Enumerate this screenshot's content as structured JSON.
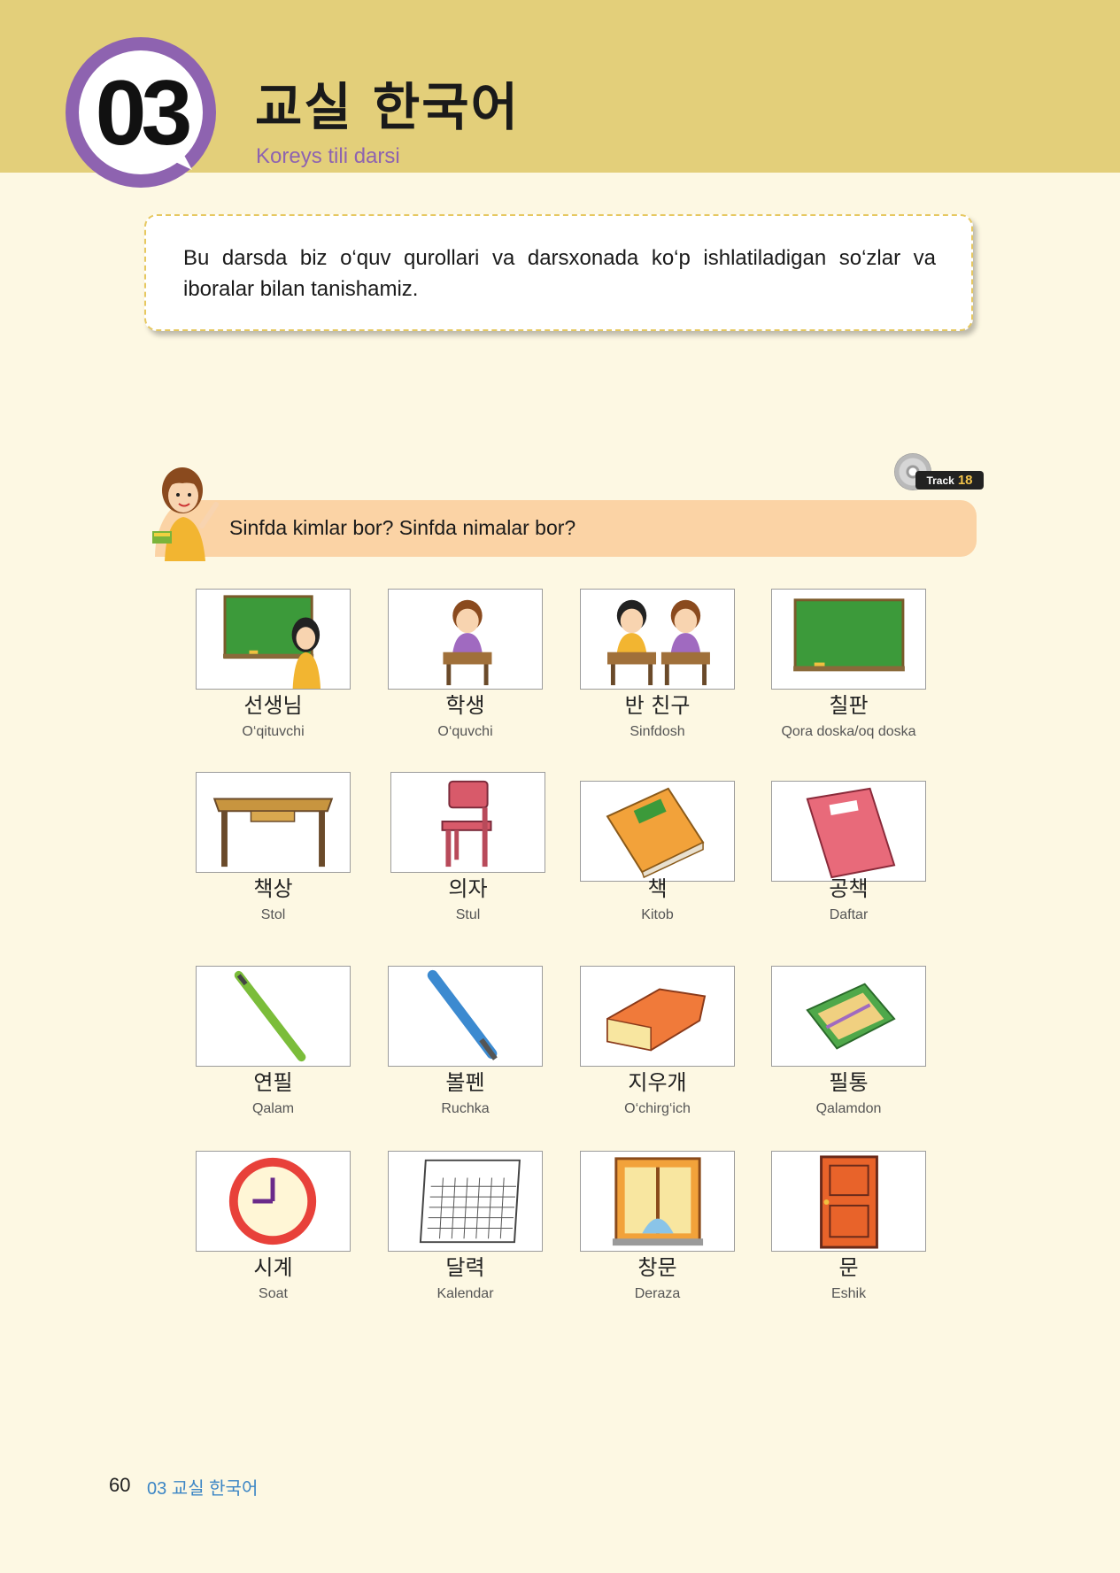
{
  "lesson": {
    "number": "03",
    "title_ko": "교실 한국어",
    "title_uz": "Koreys tili darsi"
  },
  "intro": "Bu darsda biz o‘quv qurollari va darsxonada ko‘p ishlatiladigan so‘zlar va iboralar bilan tanishamiz.",
  "track": {
    "label": "Track",
    "number": "18"
  },
  "prompt": "Sinfda kimlar bor? Sinfda nimalar bor?",
  "vocabulary": [
    {
      "ko": "선생님",
      "uz": "O‘qituvchi",
      "icon": "teacher-blackboard-icon"
    },
    {
      "ko": "학생",
      "uz": "O‘quvchi",
      "icon": "student-desk-icon"
    },
    {
      "ko": "반 친구",
      "uz": "Sinfdosh",
      "icon": "classmates-icon"
    },
    {
      "ko": "칠판",
      "uz": "Qora doska/oq doska",
      "icon": "blackboard-icon"
    },
    {
      "ko": "책상",
      "uz": "Stol",
      "icon": "desk-icon"
    },
    {
      "ko": "의자",
      "uz": "Stul",
      "icon": "chair-icon"
    },
    {
      "ko": "책",
      "uz": "Kitob",
      "icon": "book-icon"
    },
    {
      "ko": "공책",
      "uz": "Daftar",
      "icon": "notebook-icon"
    },
    {
      "ko": "연필",
      "uz": "Qalam",
      "icon": "pencil-icon"
    },
    {
      "ko": "볼펜",
      "uz": "Ruchka",
      "icon": "ballpoint-pen-icon"
    },
    {
      "ko": "지우개",
      "uz": "O‘chirg‘ich",
      "icon": "eraser-icon"
    },
    {
      "ko": "필통",
      "uz": "Qalamdon",
      "icon": "pencil-case-icon"
    },
    {
      "ko": "시계",
      "uz": "Soat",
      "icon": "clock-icon"
    },
    {
      "ko": "달력",
      "uz": "Kalendar",
      "icon": "calendar-icon"
    },
    {
      "ko": "창문",
      "uz": "Deraza",
      "icon": "window-icon"
    },
    {
      "ko": "문",
      "uz": "Eshik",
      "icon": "door-icon"
    }
  ],
  "footer": {
    "page_number": "60",
    "section": "03 교실 한국어"
  },
  "colors": {
    "header_band": "#e3cf7a",
    "page_background": "#fdf8e3",
    "badge_ring": "#8e63b0",
    "subtitle": "#8e63b0",
    "prompt_bar": "#fbd3a5",
    "footer_title": "#3c86c5"
  }
}
